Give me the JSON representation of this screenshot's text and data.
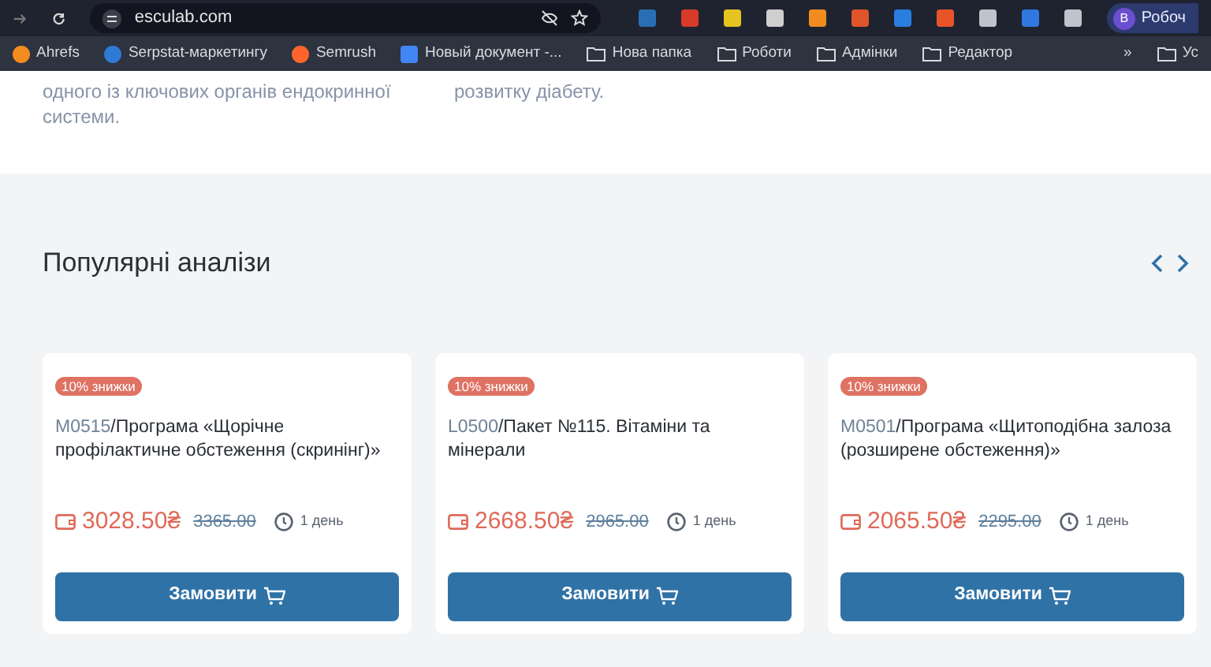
{
  "browser": {
    "url": "esculab.com",
    "profile": {
      "initial": "В",
      "name": "Робоч"
    },
    "bookmarks": [
      {
        "kind": "site",
        "label": "Ahrefs",
        "color": "#f28c1e"
      },
      {
        "kind": "site",
        "label": "Serpstat-маркетингу",
        "color": "#2f7ad6"
      },
      {
        "kind": "site",
        "label": "Semrush",
        "color": "#ff642d"
      },
      {
        "kind": "doc",
        "label": "Новый документ -...",
        "color": "#4285f4"
      },
      {
        "kind": "folder",
        "label": "Нова папка"
      },
      {
        "kind": "folder",
        "label": "Роботи"
      },
      {
        "kind": "folder",
        "label": "Адмінки"
      },
      {
        "kind": "folder",
        "label": "Редактор"
      }
    ],
    "overflow": "»",
    "other_folder": "Ус"
  },
  "intro": [
    "одного із ключових органів ендокринної системи.",
    "розвитку діабету."
  ],
  "section": {
    "title": "Популярні аналізи"
  },
  "cards": [
    {
      "badge": "10% знижки",
      "code": "M0515",
      "title": "/Програма «Щорічне профілактичне обстеження (скринінг)»",
      "price": "3028.50₴",
      "old_price": "3365.00",
      "duration": "1 день",
      "button": "Замовити"
    },
    {
      "badge": "10% знижки",
      "code": "L0500",
      "title": "/Пакет №115. Вітаміни та мінерали",
      "price": "2668.50₴",
      "old_price": "2965.00",
      "duration": "1 день",
      "button": "Замовити"
    },
    {
      "badge": "10% знижки",
      "code": "M0501",
      "title": "/Програма «Щитоподібна залоза (розширене обстеження)»",
      "price": "2065.50₴",
      "old_price": "2295.00",
      "duration": "1 день",
      "button": "Замовити"
    }
  ]
}
